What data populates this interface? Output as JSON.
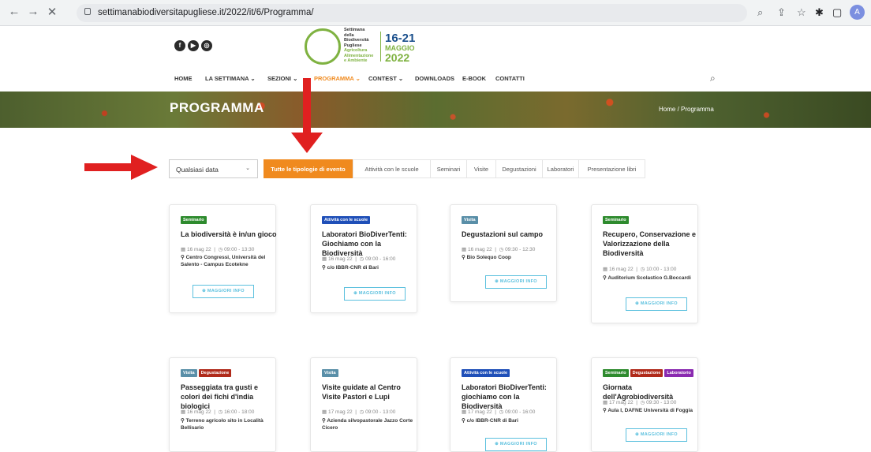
{
  "browser": {
    "url": "settimanabiodiversitapugliese.it/2022/it/6/Programma/",
    "profile": "A",
    "back": "←",
    "forward": "→",
    "close": "✕"
  },
  "logo": {
    "words": [
      "Settimana",
      "della",
      "Biodiversità",
      "Pugliese",
      "Agricoltura",
      "Alimentazione",
      "e Ambiente"
    ],
    "dates": "16-21",
    "month": "MAGGIO",
    "year": "2022"
  },
  "menu": [
    "HOME",
    "LA SETTIMANA ⌄",
    "SEZIONI ⌄",
    "PROGRAMMA ⌄",
    "CONTEST ⌄",
    "DOWNLOADS",
    "E-BOOK",
    "CONTATTI"
  ],
  "banner": {
    "title": "PROGRAMMA",
    "breadcrumb": "Home / Programma"
  },
  "filters": {
    "date": "Qualsiasi data",
    "tabs": [
      "Tutte le tipologie di evento",
      "Attività con le scuole",
      "Seminari",
      "Visite",
      "Degustazioni",
      "Laboratori",
      "Presentazione libri"
    ]
  },
  "cards": [
    {
      "tags": [
        "Seminario"
      ],
      "title": "La biodiversità è in/un gioco",
      "date": "16 mag 22",
      "time": "09:00 - 13:30",
      "place": "Centro Congressi, Università del Salento - Campus Ecotekne",
      "button": "MAGGIORI INFO"
    },
    {
      "tags": [
        "Attività con le scuole"
      ],
      "title": "Laboratori BioDiverTenti: Giochiamo con la Biodiversità",
      "date": "16 mag 22",
      "time": "09:00 - 16:00",
      "place": "c/o IBBR-CNR di Bari",
      "button": "MAGGIORI INFO"
    },
    {
      "tags": [
        "Visita"
      ],
      "title": "Degustazioni sul campo",
      "date": "16 mag 22",
      "time": "09:30 - 12:30",
      "place": "Bio Solequo Coop",
      "button": "MAGGIORI INFO"
    },
    {
      "tags": [
        "Seminario"
      ],
      "title": "Recupero, Conservazione e Valorizzazione della Biodiversità",
      "date": "16 mag 22",
      "time": "10:00 - 13:00",
      "place": "Auditorium Scolastico G.Boccardi",
      "button": "MAGGIORI INFO"
    },
    {
      "tags": [
        "Visita",
        "Degustazione"
      ],
      "title": "Passeggiata tra gusti e colori dei fichi d'india biologici",
      "date": "16 mag 22",
      "time": "16:00 - 18:00",
      "place": "Terreno agricolo sito in Località Bellisario",
      "button": ""
    },
    {
      "tags": [
        "Visita"
      ],
      "title": "Visite guidate al Centro Visite Pastori e Lupi",
      "date": "17 mag 22",
      "time": "09:00 - 13:00",
      "place": "Azienda silvopastorale Jazzo Corte Cicero",
      "button": ""
    },
    {
      "tags": [
        "Attività con le scuole"
      ],
      "title": "Laboratori BioDiverTenti: giochiamo con la Biodiversità",
      "date": "17 mag 22",
      "time": "09:00 - 16:00",
      "place": "c/o IBBR-CNR di Bari",
      "button": "MAGGIORI INFO"
    },
    {
      "tags": [
        "Seminario",
        "Degustazione",
        "Laboratorio"
      ],
      "title": "Giornata dell'Agrobiodiversità",
      "date": "17 mag 22",
      "time": "09:30 - 13:00",
      "place": "Aula I, DAFNE Università di Foggia",
      "button": "MAGGIORI INFO"
    }
  ],
  "colors": {
    "accent": "#f08a1e",
    "Seminario": "#2e8b2e",
    "Attività con le scuole": "#1f4fb8",
    "Visita": "#5a8fa8",
    "Degustazione": "#b02a1a",
    "Laboratorio": "#8a2ab0"
  }
}
